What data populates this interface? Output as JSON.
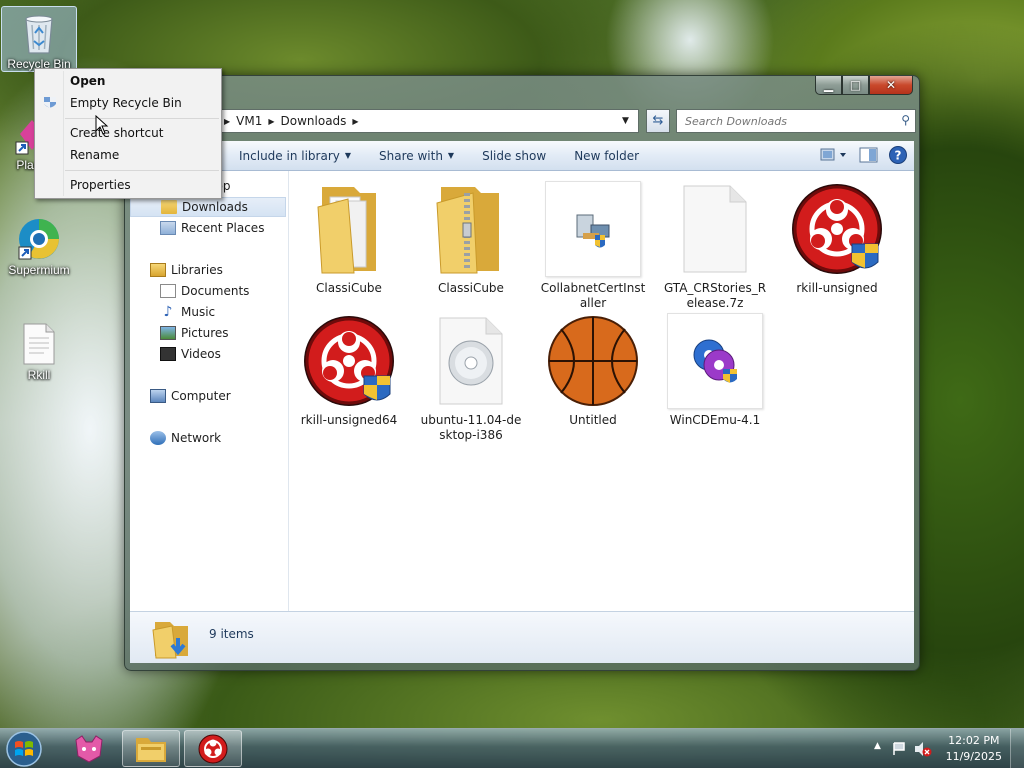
{
  "desktop": {
    "icons": [
      {
        "label": "Recycle Bin",
        "icon": "recycle-bin-icon"
      },
      {
        "label": "Plas",
        "icon": "plasma-icon"
      },
      {
        "label": "Supermium",
        "icon": "supermium-icon"
      },
      {
        "label": "Rkill",
        "icon": "document-icon"
      }
    ]
  },
  "context_menu": {
    "items": [
      {
        "label": "Open",
        "bold": true
      },
      {
        "label": "Empty Recycle Bin",
        "icon": "shield-icon"
      },
      {
        "label": "Create shortcut"
      },
      {
        "label": "Rename"
      },
      {
        "label": "Properties"
      }
    ]
  },
  "explorer": {
    "address": {
      "crumbs": [
        "VM1",
        "Downloads"
      ]
    },
    "search": {
      "placeholder": "Search Downloads"
    },
    "toolbar": {
      "include_in_library": "Include in library",
      "share_with": "Share with",
      "slide_show": "Slide show",
      "new_folder": "New folder"
    },
    "nav": {
      "desktop": "Desktop",
      "downloads": "Downloads",
      "recent_places": "Recent Places",
      "libraries": "Libraries",
      "documents": "Documents",
      "music": "Music",
      "pictures": "Pictures",
      "videos": "Videos",
      "computer": "Computer",
      "network": "Network"
    },
    "files": [
      {
        "name": "ClassiCube",
        "icon": "folder-icon"
      },
      {
        "name": "ClassiCube",
        "icon": "zip-folder-icon"
      },
      {
        "name": "CollabnetCertInstaller",
        "icon": "installer-icon"
      },
      {
        "name": "GTA_CRStories_Release.7z",
        "icon": "blank-file-icon"
      },
      {
        "name": "rkill-unsigned",
        "icon": "biohazard-icon"
      },
      {
        "name": "rkill-unsigned64",
        "icon": "biohazard-icon"
      },
      {
        "name": "ubuntu-11.04-desktop-i386",
        "icon": "disc-image-icon"
      },
      {
        "name": "Untitled",
        "icon": "basketball-icon"
      },
      {
        "name": "WinCDEmu-4.1",
        "icon": "wincdemu-icon"
      }
    ],
    "details": {
      "item_count": "9 items"
    }
  },
  "taskbar": {
    "clock": {
      "time": "12:02 PM",
      "date": "11/9/2025"
    }
  }
}
